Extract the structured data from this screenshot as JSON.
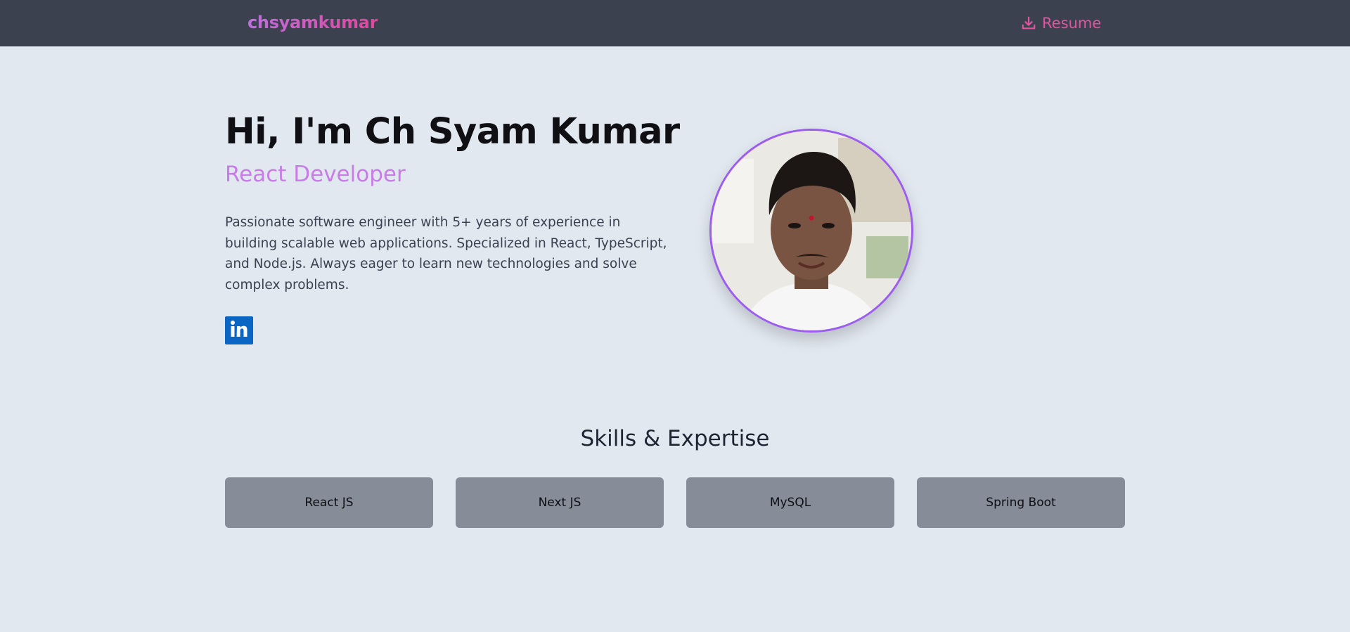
{
  "navbar": {
    "brand": "chsyamkumar",
    "resume_label": "Resume",
    "resume_icon": "download-icon",
    "accent_color": "#e1559f"
  },
  "hero": {
    "title": "Hi, I'm Ch Syam Kumar",
    "role": "React Developer",
    "bio": "Passionate software engineer with 5+ years of experience in building scalable web applications. Specialized in React, TypeScript, and Node.js. Always eager to learn new technologies and solve complex problems.",
    "social": [
      {
        "name": "linkedin-icon",
        "color": "#0a66c2"
      }
    ],
    "avatar_border_color": "#9d5cf0"
  },
  "skills": {
    "title": "Skills & Expertise",
    "items": [
      "React JS",
      "Next JS",
      "MySQL",
      "Spring Boot"
    ]
  }
}
